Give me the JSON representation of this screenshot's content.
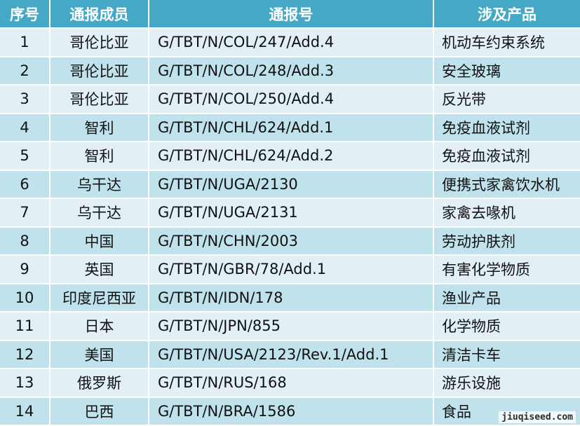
{
  "table": {
    "headers": [
      "序号",
      "通报成员",
      "通报号",
      "涉及产品"
    ],
    "rows": [
      {
        "no": "1",
        "member": "哥伦比亚",
        "code": "G/TBT/N/COL/247/Add.4",
        "product": "机动车约束系统"
      },
      {
        "no": "2",
        "member": "哥伦比亚",
        "code": "G/TBT/N/COL/248/Add.3",
        "product": "安全玻璃"
      },
      {
        "no": "3",
        "member": "哥伦比亚",
        "code": "G/TBT/N/COL/250/Add.4",
        "product": "反光带"
      },
      {
        "no": "4",
        "member": "智利",
        "code": "G/TBT/N/CHL/624/Add.1",
        "product": "免疫血液试剂"
      },
      {
        "no": "5",
        "member": "智利",
        "code": "G/TBT/N/CHL/624/Add.2",
        "product": "免疫血液试剂"
      },
      {
        "no": "6",
        "member": "乌干达",
        "code": "G/TBT/N/UGA/2130",
        "product": "便携式家禽饮水机"
      },
      {
        "no": "7",
        "member": "乌干达",
        "code": "G/TBT/N/UGA/2131",
        "product": "家禽去喙机"
      },
      {
        "no": "8",
        "member": "中国",
        "code": "G/TBT/N/CHN/2003",
        "product": "劳动护肤剂"
      },
      {
        "no": "9",
        "member": "英国",
        "code": "G/TBT/N/GBR/78/Add.1",
        "product": "有害化学物质"
      },
      {
        "no": "10",
        "member": "印度尼西亚",
        "code": "G/TBT/N/IDN/178",
        "product": "渔业产品"
      },
      {
        "no": "11",
        "member": "日本",
        "code": "G/TBT/N/JPN/855",
        "product": "化学物质"
      },
      {
        "no": "12",
        "member": "美国",
        "code": "G/TBT/N/USA/2123/Rev.1/Add.1",
        "product": "清洁卡车"
      },
      {
        "no": "13",
        "member": "俄罗斯",
        "code": "G/TBT/N/RUS/168",
        "product": "游乐设施"
      },
      {
        "no": "14",
        "member": "巴西",
        "code": "G/TBT/N/BRA/1586",
        "product": "食品"
      }
    ]
  },
  "watermark": "jiuqiseed.com"
}
